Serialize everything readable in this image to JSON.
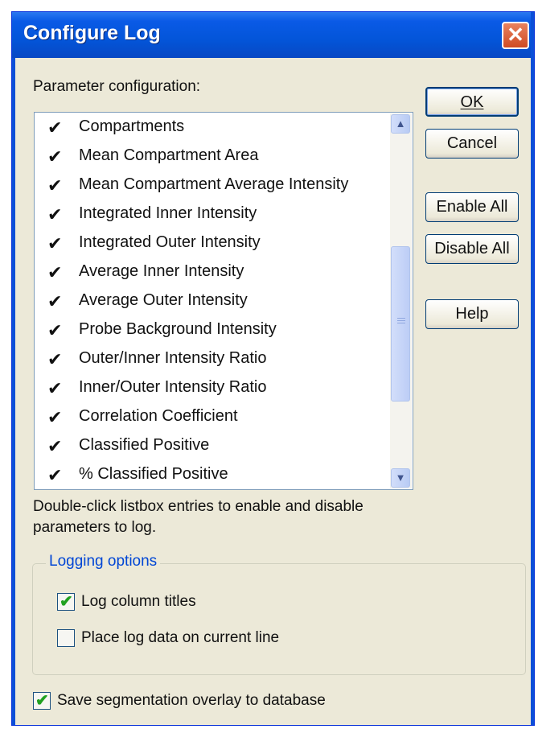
{
  "window": {
    "title": "Configure Log",
    "close_glyph": "✕"
  },
  "parameters": {
    "heading": "Parameter configuration:",
    "items": [
      {
        "label": "Compartments",
        "enabled": true
      },
      {
        "label": "Mean Compartment Area",
        "enabled": true
      },
      {
        "label": "Mean Compartment Average Intensity",
        "enabled": true
      },
      {
        "label": "Integrated Inner Intensity",
        "enabled": true
      },
      {
        "label": "Integrated Outer Intensity",
        "enabled": true
      },
      {
        "label": "Average Inner Intensity",
        "enabled": true
      },
      {
        "label": "Average Outer Intensity",
        "enabled": true
      },
      {
        "label": "Probe Background Intensity",
        "enabled": true
      },
      {
        "label": "Outer/Inner Intensity Ratio",
        "enabled": true
      },
      {
        "label": "Inner/Outer Intensity Ratio",
        "enabled": true
      },
      {
        "label": "Correlation Coefficient",
        "enabled": true
      },
      {
        "label": "Classified Positive",
        "enabled": true
      },
      {
        "label": "% Classified Positive",
        "enabled": true
      }
    ],
    "hint_line1": "Double-click listbox entries to enable and disable",
    "hint_line2": "parameters to log."
  },
  "buttons": {
    "ok": "OK",
    "cancel": "Cancel",
    "enable_all": "Enable All",
    "disable_all": "Disable All",
    "help": "Help"
  },
  "logging_options": {
    "title": "Logging options",
    "log_column_titles": {
      "label": "Log column titles",
      "checked": true
    },
    "place_on_current_line": {
      "label": "Place log data on current line",
      "checked": false
    }
  },
  "save_overlay": {
    "label": "Save segmentation overlay to database",
    "checked": true
  },
  "icons": {
    "check": "✔",
    "scroll_up": "▲",
    "scroll_down": "▼"
  },
  "colors": {
    "titlebar": "#0355d9",
    "close_button": "#cf4b23",
    "group_title": "#0046d5",
    "dialog_bg": "#ece9d8",
    "checkmark": "#21a121"
  }
}
